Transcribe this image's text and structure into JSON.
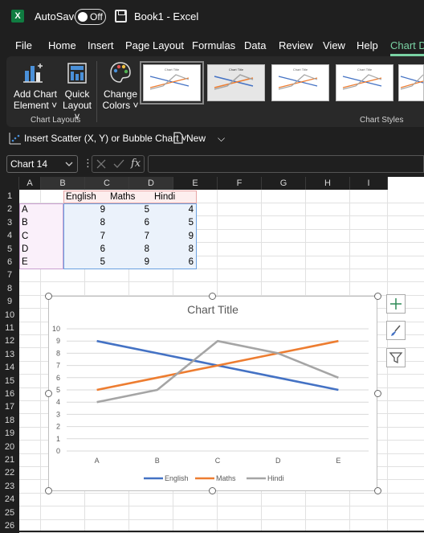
{
  "titlebar": {
    "autosave_label": "AutoSave",
    "autosave_state": "Off",
    "book_title": "Book1  -  Excel",
    "excel_icon_letter": "X"
  },
  "tabs": [
    "File",
    "Home",
    "Insert",
    "Page Layout",
    "Formulas",
    "Data",
    "Review",
    "View",
    "Help",
    "Chart D"
  ],
  "ribbon": {
    "add_chart_element": [
      "Add Chart",
      "Element ˅"
    ],
    "quick_layout": [
      "Quick",
      "Layout ˅"
    ],
    "change_colors": [
      "Change",
      "Colors ˅"
    ],
    "chart_layouts_group": "Chart Layouts",
    "chart_styles_group": "Chart Styles",
    "thumb_title": "Chart Title"
  },
  "toolbar2": {
    "insert_scatter": "Insert Scatter (X, Y) or Bubble Chart ˅",
    "new_label": "New",
    "overflow": "⌵"
  },
  "formulabar": {
    "namebox_value": "Chart 14",
    "fx": "fx"
  },
  "grid": {
    "columns": [
      "A",
      "B",
      "C",
      "D",
      "E",
      "F",
      "G",
      "H",
      "I"
    ],
    "rows": [
      "1",
      "2",
      "3",
      "4",
      "5",
      "6",
      "7",
      "8",
      "9",
      "10",
      "11",
      "12",
      "13",
      "14",
      "15",
      "16",
      "17",
      "18",
      "19",
      "20",
      "21",
      "22",
      "23",
      "24",
      "25",
      "26"
    ],
    "headers": [
      "English",
      "Maths",
      "Hindi"
    ],
    "data": [
      {
        "label": "A",
        "values": [
          "9",
          "5",
          "4"
        ]
      },
      {
        "label": "B",
        "values": [
          "8",
          "6",
          "5"
        ]
      },
      {
        "label": "C",
        "values": [
          "7",
          "7",
          "9"
        ]
      },
      {
        "label": "D",
        "values": [
          "6",
          "8",
          "8"
        ]
      },
      {
        "label": "E",
        "values": [
          "5",
          "9",
          "6"
        ]
      }
    ]
  },
  "chart_data": {
    "type": "line",
    "title": "Chart Title",
    "categories": [
      "A",
      "B",
      "C",
      "D",
      "E"
    ],
    "series": [
      {
        "name": "English",
        "values": [
          9,
          8,
          7,
          6,
          5
        ],
        "color": "#4472c4"
      },
      {
        "name": "Maths",
        "values": [
          5,
          6,
          7,
          8,
          9
        ],
        "color": "#ed7d31"
      },
      {
        "name": "Hindi",
        "values": [
          4,
          5,
          9,
          8,
          6
        ],
        "color": "#a5a5a5"
      }
    ],
    "ylim": [
      0,
      10
    ],
    "yticks": [
      "0",
      "1",
      "2",
      "3",
      "4",
      "5",
      "6",
      "7",
      "8",
      "9",
      "10"
    ],
    "grid": true,
    "legend": "bottom"
  }
}
